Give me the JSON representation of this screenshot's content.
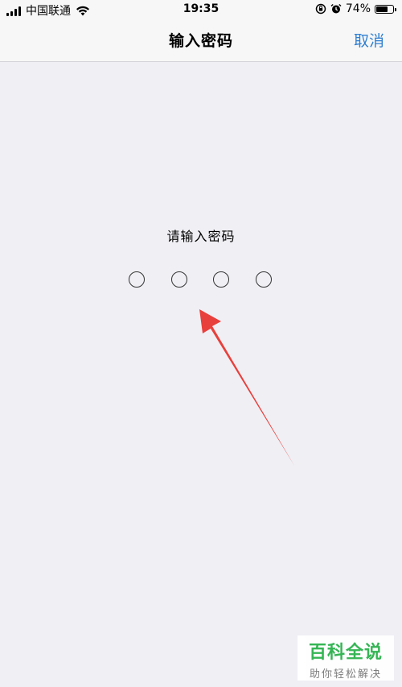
{
  "status_bar": {
    "carrier": "中国联通",
    "time": "19:35",
    "battery_percent_label": "74%",
    "battery_level": 0.74,
    "icons": [
      "signal-icon",
      "wifi-icon",
      "rotation-lock-icon",
      "alarm-icon",
      "battery-icon"
    ]
  },
  "nav": {
    "title": "输入密码",
    "cancel_label": "取消"
  },
  "passcode": {
    "prompt": "请输入密码",
    "digit_count": 4,
    "entered_count": 0
  },
  "annotation": {
    "arrow_color": "#e8403c"
  },
  "watermark": {
    "title": "百科全说",
    "subtitle": "助你轻松解决"
  },
  "colors": {
    "background": "#efeff4",
    "bar_background": "#f7f7f7",
    "accent": "#2f7fd1",
    "watermark_green": "#2bb24c"
  }
}
